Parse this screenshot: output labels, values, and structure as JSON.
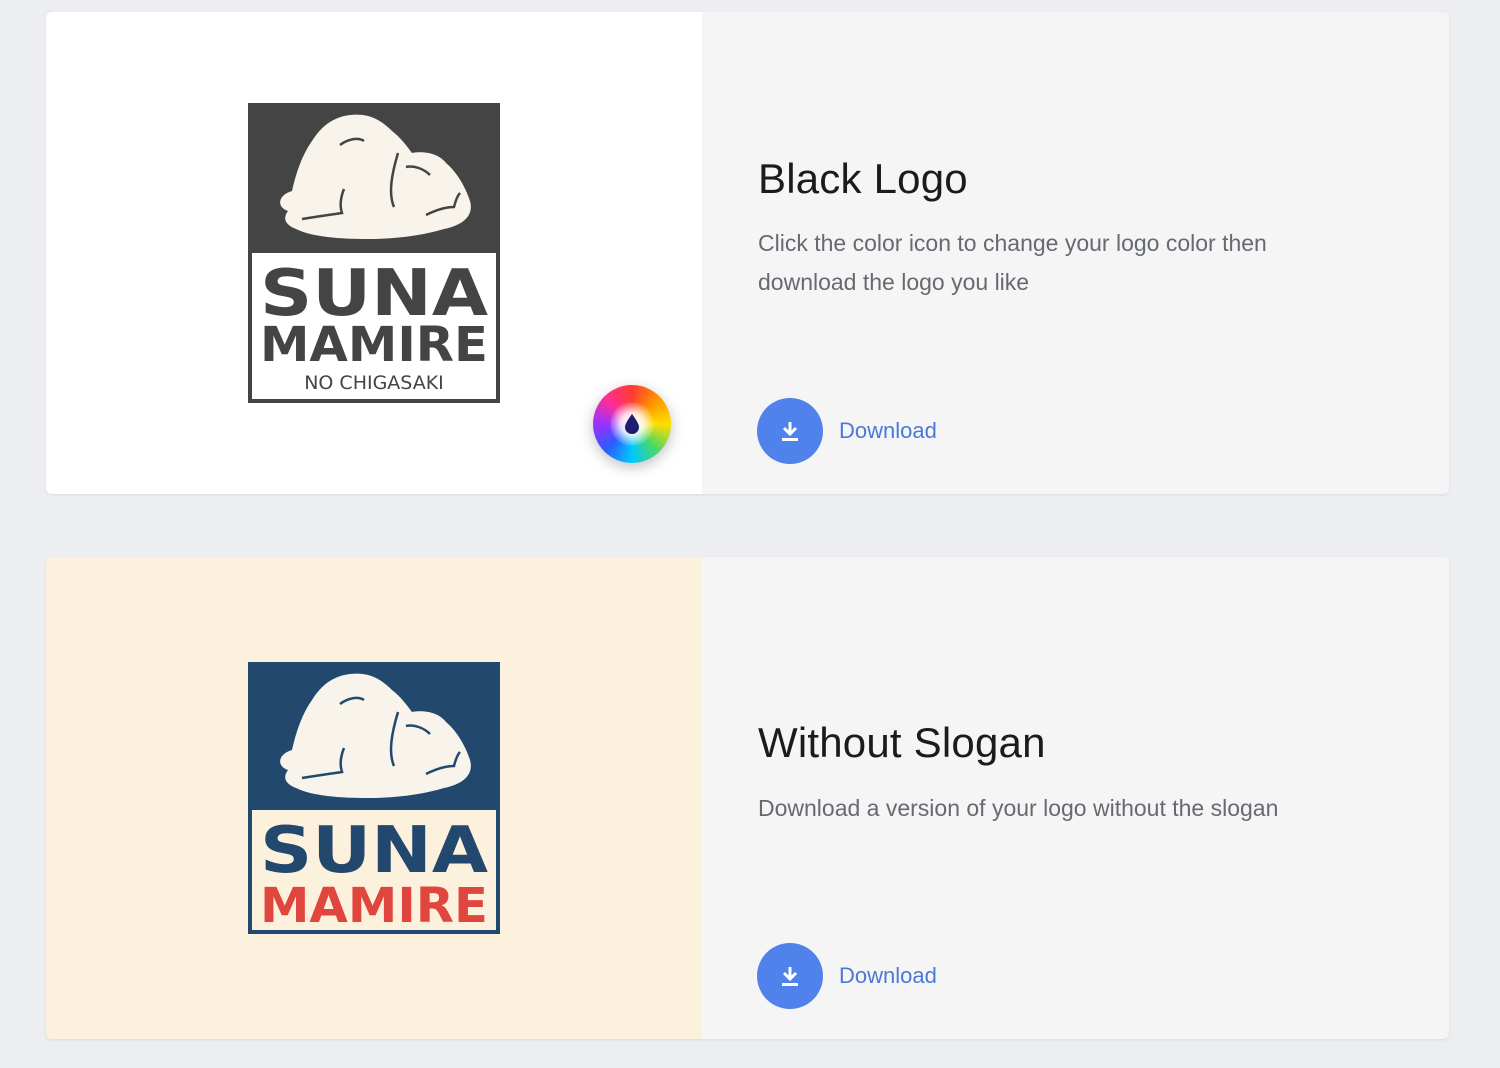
{
  "colors": {
    "page_bg": "#eceef2",
    "info_bg": "#f5f5f6",
    "accent": "#4f82ea",
    "link": "#4a78d6",
    "black_logo_bg": "#444444",
    "navy_logo_bg": "#23486e",
    "red_logo_text": "#e0463e",
    "cream_preview_bg": "#fcf1dd",
    "rock_fill": "#f8f4ec"
  },
  "black_logo": {
    "title": "Black Logo",
    "description": "Click the color icon to change your logo color then download the logo you like",
    "download_label": "Download",
    "logo_text_line1": "SUNA",
    "logo_text_line2": "MAMIRE",
    "logo_slogan": "NO CHIGASAKI",
    "color_icon": "color-wheel-icon"
  },
  "without_slogan": {
    "title": "Without Slogan",
    "description": "Download a version of your logo without the slogan",
    "download_label": "Download",
    "logo_text_line1": "SUNA",
    "logo_text_line2": "MAMIRE"
  },
  "icons": {
    "download": "download-icon",
    "color_picker": "color-drop-icon"
  }
}
